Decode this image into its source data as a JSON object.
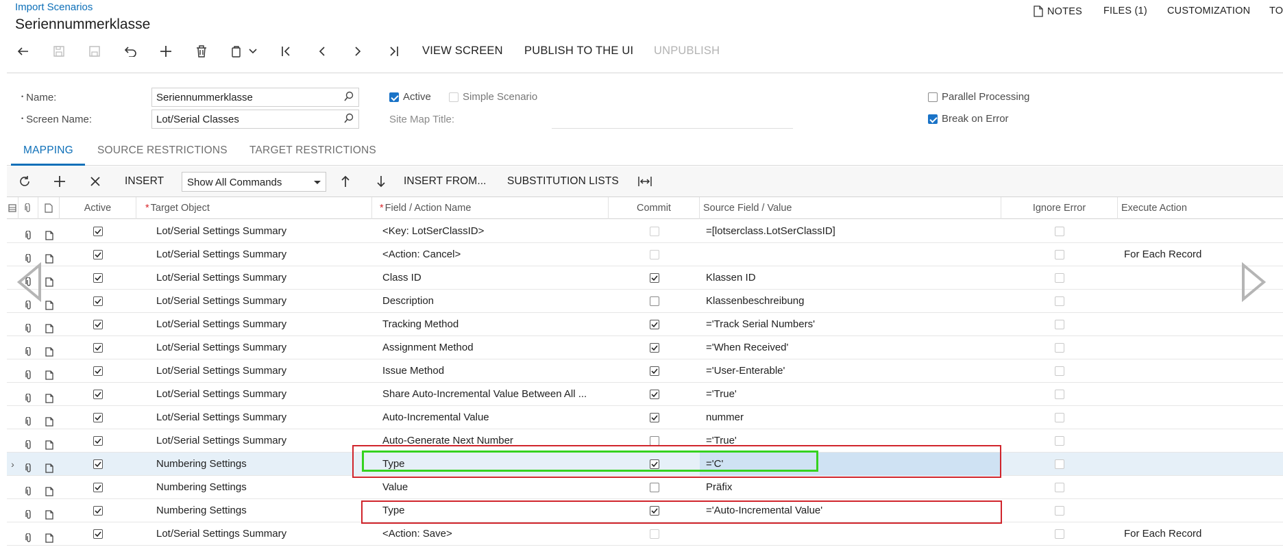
{
  "breadcrumb": "Import Scenarios",
  "page_title": "Seriennummerklasse",
  "top_actions": {
    "notes": "NOTES",
    "files": "FILES (1)",
    "customization": "CUSTOMIZATION",
    "tools": "TO"
  },
  "toolbar": {
    "view_screen": "VIEW SCREEN",
    "publish": "PUBLISH TO THE UI",
    "unpublish": "UNPUBLISH"
  },
  "form": {
    "name_label": "Name:",
    "name_value": "Seriennummerklasse",
    "screen_label": "Screen Name:",
    "screen_value": "Lot/Serial Classes",
    "active_label": "Active",
    "active_checked": true,
    "simple_label": "Simple Scenario",
    "simple_checked": false,
    "sitemap_label": "Site Map Title:",
    "parallel_label": "Parallel Processing",
    "parallel_checked": false,
    "break_label": "Break on Error",
    "break_checked": true
  },
  "tabs": {
    "mapping": "MAPPING",
    "source": "SOURCE RESTRICTIONS",
    "target": "TARGET RESTRICTIONS"
  },
  "grid_toolbar": {
    "insert": "INSERT",
    "show_commands": "Show All Commands",
    "insert_from": "INSERT FROM...",
    "substitution": "SUBSTITUTION LISTS"
  },
  "columns": {
    "active": "Active",
    "target_object": "Target Object",
    "field_action": "Field / Action Name",
    "commit": "Commit",
    "source": "Source Field / Value",
    "ignore_error": "Ignore Error",
    "execute_action": "Execute Action"
  },
  "rows": [
    {
      "target": "Lot/Serial Settings Summary",
      "field": "<Key: LotSerClassID>",
      "commit": false,
      "commit_dis": true,
      "source": "=[lotserclass.LotSerClassID]",
      "execute": ""
    },
    {
      "target": "Lot/Serial Settings Summary",
      "field": "<Action: Cancel>",
      "commit": false,
      "commit_dis": true,
      "source": "",
      "execute": "For Each Record"
    },
    {
      "target": "Lot/Serial Settings Summary",
      "field": "Class ID",
      "commit": true,
      "commit_dis": false,
      "source": "Klassen ID",
      "execute": ""
    },
    {
      "target": "Lot/Serial Settings Summary",
      "field": "Description",
      "commit": false,
      "commit_dis": false,
      "source": "Klassenbeschreibung",
      "execute": ""
    },
    {
      "target": "Lot/Serial Settings Summary",
      "field": "Tracking Method",
      "commit": true,
      "commit_dis": false,
      "source": "='Track Serial Numbers'",
      "execute": ""
    },
    {
      "target": "Lot/Serial Settings Summary",
      "field": "Assignment Method",
      "commit": true,
      "commit_dis": false,
      "source": "='When Received'",
      "execute": ""
    },
    {
      "target": "Lot/Serial Settings Summary",
      "field": "Issue Method",
      "commit": true,
      "commit_dis": false,
      "source": "='User-Enterable'",
      "execute": ""
    },
    {
      "target": "Lot/Serial Settings Summary",
      "field": "Share Auto-Incremental Value Between All ...",
      "commit": true,
      "commit_dis": false,
      "source": "='True'",
      "execute": ""
    },
    {
      "target": "Lot/Serial Settings Summary",
      "field": "Auto-Incremental Value",
      "commit": true,
      "commit_dis": false,
      "source": "nummer",
      "execute": ""
    },
    {
      "target": "Lot/Serial Settings Summary",
      "field": "Auto-Generate Next Number",
      "commit": false,
      "commit_dis": false,
      "source": "='True'",
      "execute": ""
    },
    {
      "target": "Numbering Settings",
      "field": "Type",
      "commit": true,
      "commit_dis": false,
      "source": "='C'",
      "execute": "",
      "selected": true
    },
    {
      "target": "Numbering Settings",
      "field": "Value",
      "commit": false,
      "commit_dis": false,
      "source": "Präfix",
      "execute": ""
    },
    {
      "target": "Numbering Settings",
      "field": "Type",
      "commit": true,
      "commit_dis": false,
      "source": "='Auto-Incremental Value'",
      "execute": ""
    },
    {
      "target": "Lot/Serial Settings Summary",
      "field": "<Action: Save>",
      "commit": false,
      "commit_dis": true,
      "source": "",
      "execute": "For Each Record"
    }
  ]
}
